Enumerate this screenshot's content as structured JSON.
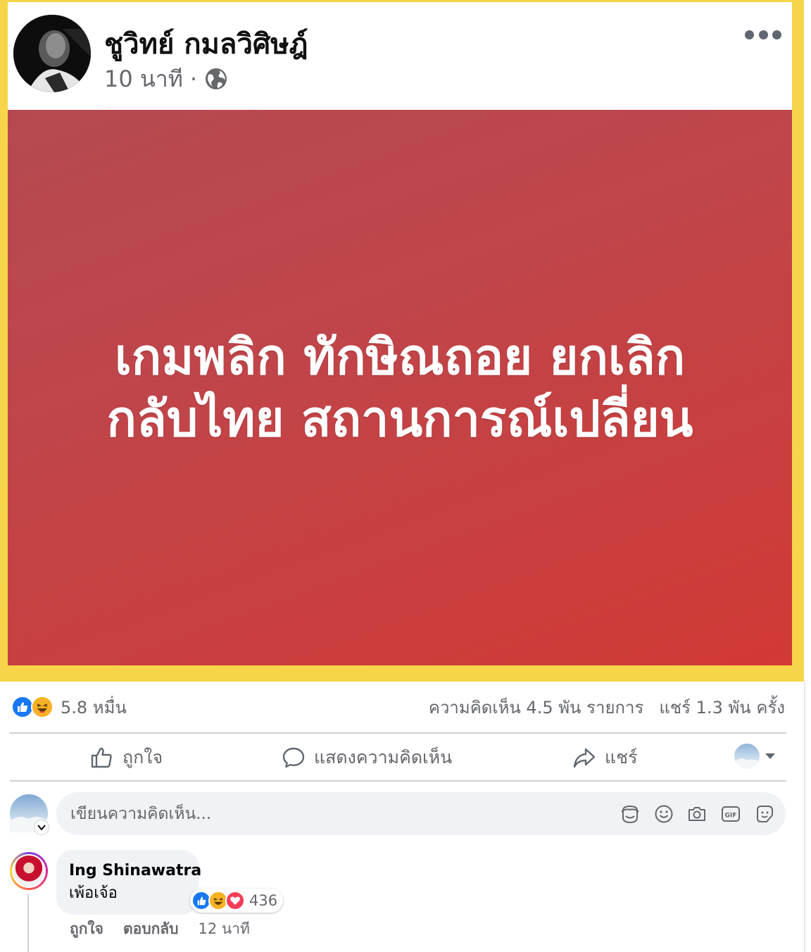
{
  "post": {
    "author": "ชูวิทย์ กมลวิศิษฎ์",
    "time": "10 นาที",
    "separator": "·",
    "privacy_icon": "globe-icon",
    "more_icon": "more-horizontal-icon"
  },
  "image": {
    "line1": "เกมพลิก ทักษิณถอย ยกเลิก",
    "line2": "กลับไทย สถานการณ์เปลี่ยน",
    "colors": {
      "start": "#b44a50",
      "end": "#d13a35"
    }
  },
  "summary": {
    "reactions": [
      "like",
      "haha"
    ],
    "reaction_count": "5.8 หมื่น",
    "comments": "ความคิดเห็น 4.5 พัน รายการ",
    "shares": "แชร์ 1.3 พัน ครั้ง"
  },
  "actions": {
    "like": "ถูกใจ",
    "comment": "แสดงความคิดเห็น",
    "share": "แชร์"
  },
  "composer": {
    "placeholder": "เขียนความคิดเห็น...",
    "icons": [
      "avatar-sticker-icon",
      "emoji-icon",
      "camera-icon",
      "gif-icon",
      "sticker-icon"
    ]
  },
  "comment": {
    "author": "Ing Shinawatra",
    "text": "เพ้อเจ้อ",
    "reactions": [
      "like",
      "haha",
      "love"
    ],
    "reaction_count": "436",
    "like_label": "ถูกใจ",
    "reply_label": "ตอบกลับ",
    "time": "12 นาที"
  },
  "colors": {
    "frame": "#f7d54a",
    "like_blue": "#1877f2",
    "haha_yellow": "#f7b125",
    "love_red": "#f33e58",
    "secondary_text": "#65676b"
  }
}
